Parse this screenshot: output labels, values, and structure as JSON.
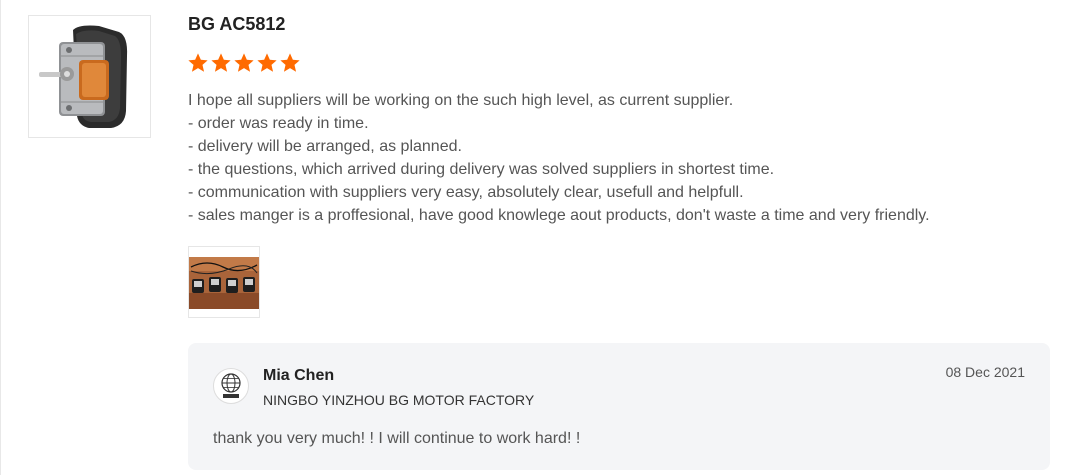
{
  "product": {
    "name": "BG AC5812",
    "image_icon": "shaded-pole-motor-product-photo"
  },
  "rating": {
    "stars": 5,
    "max": 5,
    "star_color": "#ff6a00"
  },
  "review": {
    "lines": [
      "I hope all suppliers will be working on the such high level, as current supplier.",
      "- order was ready in time.",
      "- delivery will be arranged, as planned.",
      "- the questions, which arrived during delivery was solved suppliers in shortest time.",
      "- communication with suppliers very easy, absolutely clear, usefull and helpfull.",
      "- sales manger is a proffesional, have good knowlege aout products, don't waste a time and very friendly."
    ],
    "photo_icon": "motors-row-photo"
  },
  "reply": {
    "name": "Mia Chen",
    "company": "NINGBO YINZHOU BG MOTOR FACTORY",
    "date": "08 Dec 2021",
    "text": "thank you very much! ! I will continue to work hard! !",
    "avatar_icon": "globe-logo-icon"
  }
}
